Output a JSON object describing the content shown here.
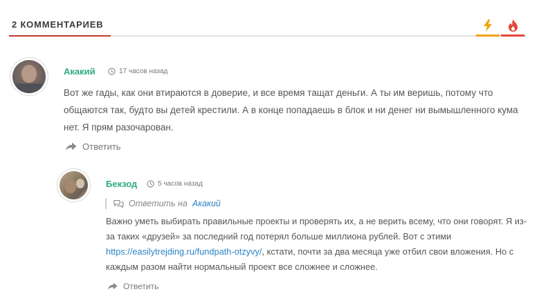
{
  "header": {
    "title": "2 КОММЕНТАРИЕВ"
  },
  "sort": {
    "new_icon": "lightning-icon",
    "hot_icon": "flame-icon",
    "new_color": "#f0a30a",
    "hot_color": "#e4483a"
  },
  "comments": [
    {
      "author": "Акакий",
      "time": "17 часов назад",
      "text": "Вот же гады, как они втираются в доверие, и все время тащат деньги. А ты им веришь, потому что общаются так, будто вы детей крестили. А в конце попадаешь в блок и ни денег ни вымышленного кума нет. Я прям разочарован.",
      "reply_label": "Ответить"
    },
    {
      "author": "Бекзод",
      "time": "5 часов назад",
      "reply_to_label": "Ответить на",
      "reply_to_name": "Акакий",
      "text_before_link": "Важно уметь выбирать правильные проекты и проверять их, а не верить всему, что они говорят. Я из-за таких «друзей» за последний год потерял больше миллиона рублей. Вот с этими ",
      "link": "https://easilytrejding.ru/fundpath-otzyvy/",
      "text_after_link": ", кстати, почти за два месяца уже отбил свои вложения. Но с каждым разом найти нормальный проект все сложнее и сложнее.",
      "reply_label": "Ответить"
    }
  ],
  "colors": {
    "accent_red": "#c0392b",
    "author_green": "#2eaa86",
    "link_blue": "#2d83c4"
  }
}
